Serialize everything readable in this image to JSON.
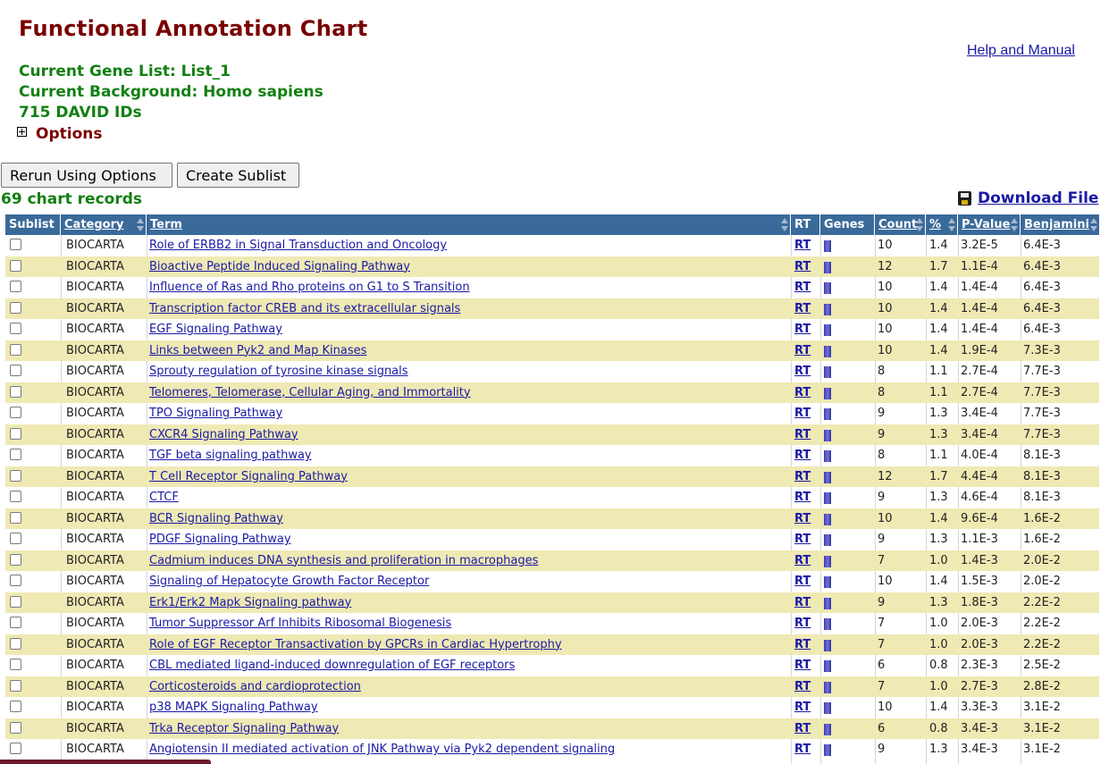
{
  "page": {
    "title": "Functional Annotation Chart",
    "help_link": "Help and Manual",
    "gene_list": "Current Gene List: List_1",
    "background": "Current Background: Homo sapiens",
    "david_ids": "715 DAVID IDs",
    "options_label": "Options"
  },
  "toolbar": {
    "rerun_label": "Rerun Using Options",
    "sublist_label": "Create Sublist"
  },
  "records_label": "69 chart records",
  "download_label": "Download File",
  "table": {
    "headers": {
      "sublist": "Sublist",
      "category": "Category",
      "term": "Term",
      "rt": "RT",
      "genes": "Genes",
      "count": "Count",
      "percent": "%",
      "pvalue": "P-Value",
      "benjamini": "Benjamini"
    },
    "rows": [
      {
        "category": "BIOCARTA",
        "term": "Role of ERBB2 in Signal Transduction and Oncology",
        "rt": "RT",
        "count": "10",
        "percent": "1.4",
        "pvalue": "3.2E-5",
        "benjamini": "6.4E-3"
      },
      {
        "category": "BIOCARTA",
        "term": "Bioactive Peptide Induced Signaling Pathway",
        "rt": "RT",
        "count": "12",
        "percent": "1.7",
        "pvalue": "1.1E-4",
        "benjamini": "6.4E-3"
      },
      {
        "category": "BIOCARTA",
        "term": "Influence of Ras and Rho proteins on G1 to S Transition",
        "rt": "RT",
        "count": "10",
        "percent": "1.4",
        "pvalue": "1.4E-4",
        "benjamini": "6.4E-3"
      },
      {
        "category": "BIOCARTA",
        "term": "Transcription factor CREB and its extracellular signals",
        "rt": "RT",
        "count": "10",
        "percent": "1.4",
        "pvalue": "1.4E-4",
        "benjamini": "6.4E-3"
      },
      {
        "category": "BIOCARTA",
        "term": "EGF Signaling Pathway",
        "rt": "RT",
        "count": "10",
        "percent": "1.4",
        "pvalue": "1.4E-4",
        "benjamini": "6.4E-3"
      },
      {
        "category": "BIOCARTA",
        "term": "Links between Pyk2 and Map Kinases",
        "rt": "RT",
        "count": "10",
        "percent": "1.4",
        "pvalue": "1.9E-4",
        "benjamini": "7.3E-3"
      },
      {
        "category": "BIOCARTA",
        "term": "Sprouty regulation of tyrosine kinase signals",
        "rt": "RT",
        "count": "8",
        "percent": "1.1",
        "pvalue": "2.7E-4",
        "benjamini": "7.7E-3"
      },
      {
        "category": "BIOCARTA",
        "term": "Telomeres, Telomerase, Cellular Aging, and Immortality",
        "rt": "RT",
        "count": "8",
        "percent": "1.1",
        "pvalue": "2.7E-4",
        "benjamini": "7.7E-3"
      },
      {
        "category": "BIOCARTA",
        "term": "TPO Signaling Pathway",
        "rt": "RT",
        "count": "9",
        "percent": "1.3",
        "pvalue": "3.4E-4",
        "benjamini": "7.7E-3"
      },
      {
        "category": "BIOCARTA",
        "term": "CXCR4 Signaling Pathway",
        "rt": "RT",
        "count": "9",
        "percent": "1.3",
        "pvalue": "3.4E-4",
        "benjamini": "7.7E-3"
      },
      {
        "category": "BIOCARTA",
        "term": "TGF beta signaling pathway",
        "rt": "RT",
        "count": "8",
        "percent": "1.1",
        "pvalue": "4.0E-4",
        "benjamini": "8.1E-3"
      },
      {
        "category": "BIOCARTA",
        "term": "T Cell Receptor Signaling Pathway",
        "rt": "RT",
        "count": "12",
        "percent": "1.7",
        "pvalue": "4.4E-4",
        "benjamini": "8.1E-3"
      },
      {
        "category": "BIOCARTA",
        "term": "CTCF",
        "rt": "RT",
        "count": "9",
        "percent": "1.3",
        "pvalue": "4.6E-4",
        "benjamini": "8.1E-3"
      },
      {
        "category": "BIOCARTA",
        "term": "BCR Signaling Pathway",
        "rt": "RT",
        "count": "10",
        "percent": "1.4",
        "pvalue": "9.6E-4",
        "benjamini": "1.6E-2"
      },
      {
        "category": "BIOCARTA",
        "term": "PDGF Signaling Pathway",
        "rt": "RT",
        "count": "9",
        "percent": "1.3",
        "pvalue": "1.1E-3",
        "benjamini": "1.6E-2"
      },
      {
        "category": "BIOCARTA",
        "term": "Cadmium induces DNA synthesis and proliferation in macrophages",
        "rt": "RT",
        "count": "7",
        "percent": "1.0",
        "pvalue": "1.4E-3",
        "benjamini": "2.0E-2"
      },
      {
        "category": "BIOCARTA",
        "term": "Signaling of Hepatocyte Growth Factor Receptor",
        "rt": "RT",
        "count": "10",
        "percent": "1.4",
        "pvalue": "1.5E-3",
        "benjamini": "2.0E-2"
      },
      {
        "category": "BIOCARTA",
        "term": "Erk1/Erk2 Mapk Signaling pathway",
        "rt": "RT",
        "count": "9",
        "percent": "1.3",
        "pvalue": "1.8E-3",
        "benjamini": "2.2E-2"
      },
      {
        "category": "BIOCARTA",
        "term": "Tumor Suppressor Arf Inhibits Ribosomal Biogenesis",
        "rt": "RT",
        "count": "7",
        "percent": "1.0",
        "pvalue": "2.0E-3",
        "benjamini": "2.2E-2"
      },
      {
        "category": "BIOCARTA",
        "term": "Role of EGF Receptor Transactivation by GPCRs in Cardiac Hypertrophy",
        "rt": "RT",
        "count": "7",
        "percent": "1.0",
        "pvalue": "2.0E-3",
        "benjamini": "2.2E-2"
      },
      {
        "category": "BIOCARTA",
        "term": "CBL mediated ligand-induced downregulation of EGF receptors",
        "rt": "RT",
        "count": "6",
        "percent": "0.8",
        "pvalue": "2.3E-3",
        "benjamini": "2.5E-2"
      },
      {
        "category": "BIOCARTA",
        "term": "Corticosteroids and cardioprotection",
        "rt": "RT",
        "count": "7",
        "percent": "1.0",
        "pvalue": "2.7E-3",
        "benjamini": "2.8E-2"
      },
      {
        "category": "BIOCARTA",
        "term": "p38 MAPK Signaling Pathway",
        "rt": "RT",
        "count": "10",
        "percent": "1.4",
        "pvalue": "3.3E-3",
        "benjamini": "3.1E-2"
      },
      {
        "category": "BIOCARTA",
        "term": "Trka Receptor Signaling Pathway",
        "rt": "RT",
        "count": "6",
        "percent": "0.8",
        "pvalue": "3.4E-3",
        "benjamini": "3.1E-2"
      },
      {
        "category": "BIOCARTA",
        "term": "Angiotensin II mediated activation of JNK Pathway via Pyk2 dependent signaling",
        "rt": "RT",
        "count": "9",
        "percent": "1.3",
        "pvalue": "3.4E-3",
        "benjamini": "3.1E-2"
      }
    ]
  },
  "colors": {
    "title": "#7a0000",
    "info_green": "#138013",
    "header_bg": "#3a6a9a",
    "row_alt": "#efe9b4",
    "link": "#1a1aa6",
    "gene_bar": "#3c3cb4"
  },
  "icons": {
    "options_toggle": "plus-box-icon",
    "download": "disk-icon",
    "sort": "sort-arrows-icon",
    "genes": "gene-bar-icon"
  }
}
